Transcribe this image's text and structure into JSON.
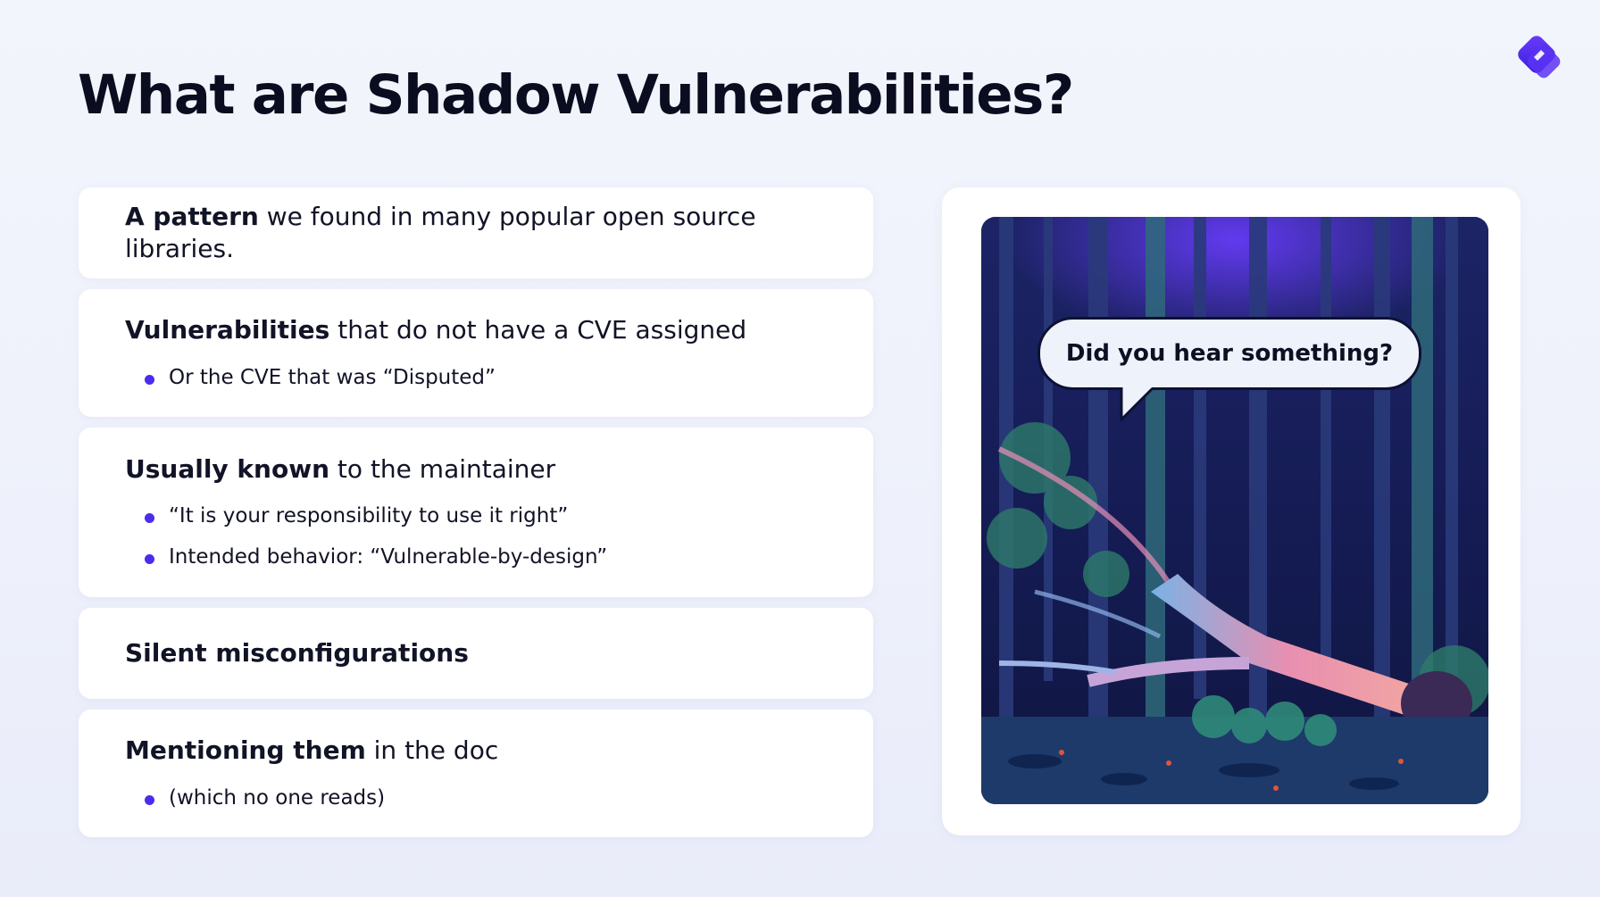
{
  "slide": {
    "title": "What are Shadow Vulnerabilities?",
    "logo_icon": "brand-logo-icon",
    "accent_color": "#4a2cf0"
  },
  "cards": [
    {
      "bold": "A pattern",
      "rest": " we found in many popular open source libraries.",
      "bullets": []
    },
    {
      "bold": "Vulnerabilities",
      "rest": " that do not have a CVE assigned",
      "bullets": [
        "Or the CVE that was “Disputed”"
      ]
    },
    {
      "bold": "Usually known",
      "rest": " to the maintainer",
      "bullets": [
        "“It is your responsibility to use it right”",
        "Intended behavior: “Vulnerable-by-design”"
      ]
    },
    {
      "bold": "Silent misconfigurations",
      "rest": "",
      "bullets": []
    },
    {
      "bold": "Mentioning them",
      "rest": " in the doc",
      "bullets": [
        "(which no one reads)"
      ]
    }
  ],
  "illustration": {
    "speech_bubble": "Did you hear something?",
    "scene_icon": "forest-fallen-tree-illustration"
  }
}
